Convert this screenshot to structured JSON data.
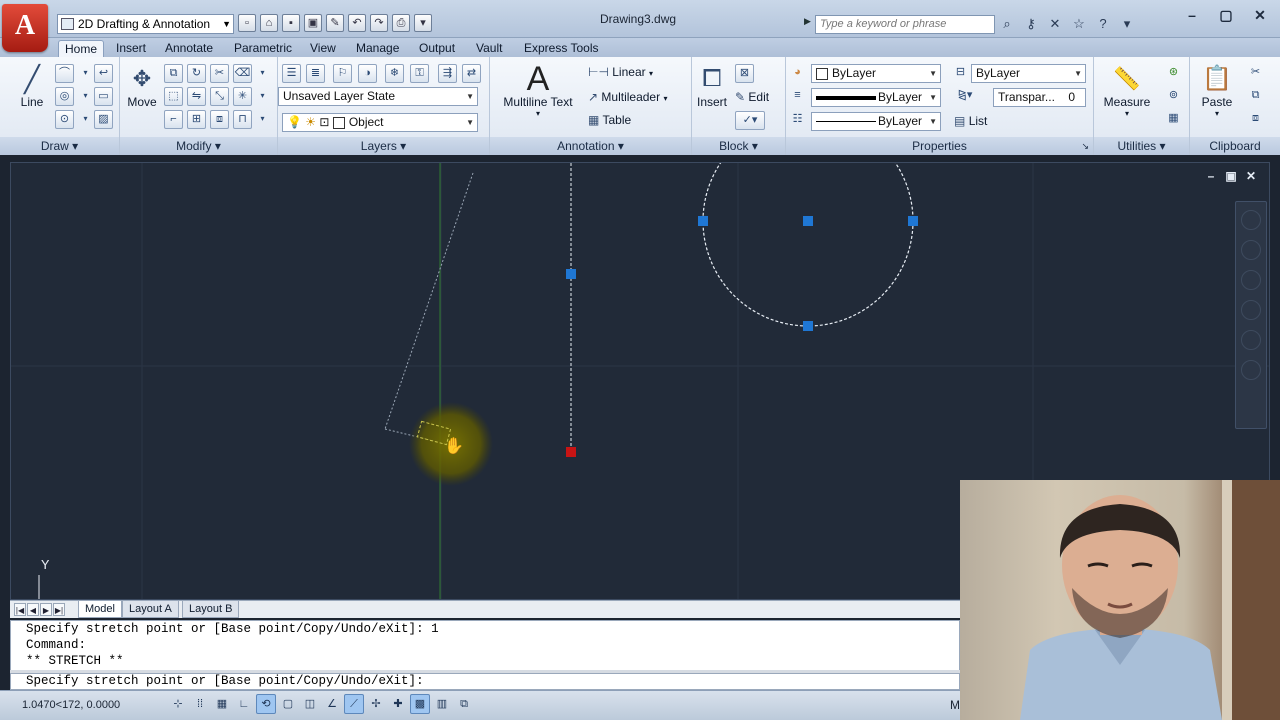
{
  "app": {
    "logo_letter": "A",
    "document_title": "Drawing3.dwg"
  },
  "workspace": {
    "value": "2D Drafting & Annotation"
  },
  "search": {
    "placeholder": "Type a keyword or phrase"
  },
  "ribbon_tabs": [
    "Home",
    "Insert",
    "Annotate",
    "Parametric",
    "View",
    "Manage",
    "Output",
    "Vault",
    "Express Tools"
  ],
  "active_tab": "Home",
  "panels": {
    "draw": {
      "title": "Draw",
      "line_label": "Line"
    },
    "modify": {
      "title": "Modify",
      "move_label": "Move"
    },
    "layers": {
      "title": "Layers",
      "layer_state": "Unsaved Layer State",
      "current_layer": "Object"
    },
    "annotation": {
      "title": "Annotation",
      "multiline_text": "Multiline Text",
      "multiline_glyph": "A",
      "linear": "Linear",
      "multileader": "Multileader",
      "table": "Table"
    },
    "block": {
      "title": "Block",
      "insert": "Insert",
      "edit": "Edit"
    },
    "properties": {
      "title": "Properties",
      "color": "ByLayer",
      "lineweight": "ByLayer",
      "linetype": "ByLayer",
      "plotstyle": "ByLayer",
      "transparency_label": "Transpar...",
      "transparency_value": "0",
      "list": "List"
    },
    "utilities": {
      "title": "Utilities",
      "measure": "Measure"
    },
    "clipboard": {
      "title": "Clipboard",
      "paste": "Paste"
    }
  },
  "canvas": {
    "ucs_label": "Y"
  },
  "layout_tabs": [
    "Model",
    "Layout A",
    "Layout B"
  ],
  "active_layout": "Model",
  "command_history": [
    "Specify stretch point or [Base point/Copy/Undo/eXit]: 1",
    "Command:",
    "** STRETCH **"
  ],
  "command_prompt": "Specify stretch point or [Base point/Copy/Undo/eXit]:",
  "status": {
    "coordinates": "1.0470<172, 0.0000",
    "overflow_label": "M"
  },
  "colors": {
    "canvas_bg": "#212a38",
    "grip_blue": "#1f77d4",
    "grip_hot": "#c81414",
    "cursor_glow": "#6b6a00"
  }
}
